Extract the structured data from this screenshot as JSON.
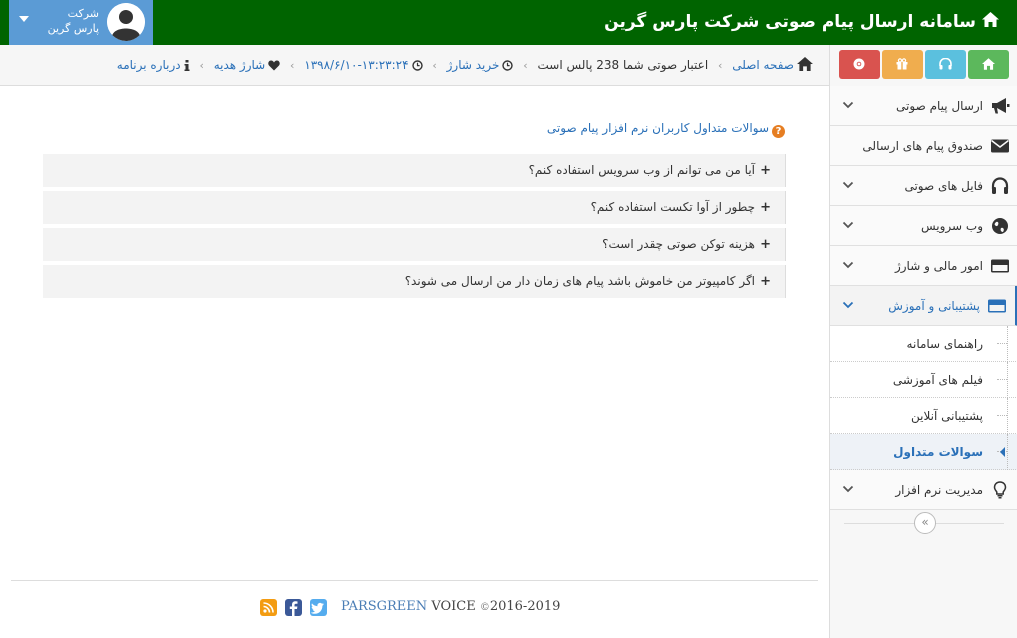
{
  "header": {
    "title": "سامانه ارسال پیام صوتی شرکت پارس گرین",
    "user_line1": "شرکت",
    "user_line2": "پارس گرین"
  },
  "breadcrumb": {
    "home": "صفحه اصلی",
    "credit": "اعتبار صوتی شما 238 پالس است",
    "buy": "خرید شارژ",
    "datetime": "۱۳۹۸/۶/۱۰-۱۳:۲۳:۲۴",
    "gift": "شارژ هدیه",
    "about": "درباره برنامه"
  },
  "colors": {
    "header_bg": "#006400",
    "user_bg": "#5b9bd5",
    "btn_green": "#5cb85c",
    "btn_blue": "#5bc0de",
    "btn_orange": "#f0ad4e",
    "btn_red": "#d9534f",
    "link": "#2a70b8"
  },
  "sidebar": {
    "top_buttons": [
      "home-icon",
      "headphones-icon",
      "gift-icon",
      "chrome-icon"
    ],
    "items": [
      {
        "label": "ارسال پیام صوتی",
        "icon": "megaphone-icon",
        "chevron": true
      },
      {
        "label": "صندوق پیام های ارسالی",
        "icon": "envelope-icon",
        "chevron": false
      },
      {
        "label": "فایل های صوتی",
        "icon": "headphones-icon",
        "chevron": true
      },
      {
        "label": "وب سرویس",
        "icon": "globe-icon",
        "chevron": true
      },
      {
        "label": "امور مالی و شارژ",
        "icon": "credit-card-icon",
        "chevron": true
      },
      {
        "label": "پشتیبانی و آموزش",
        "icon": "credit-card-icon",
        "chevron": true
      }
    ],
    "sub_items": [
      "راهنمای سامانه",
      "فیلم های آموزشی",
      "پشتیبانی آنلاین",
      "سوالات متداول"
    ],
    "last_item": {
      "label": "مدیریت نرم افزار",
      "icon": "lightbulb-icon"
    },
    "collapse": "«"
  },
  "faq": {
    "title": "سوالات متداول کاربران نرم افزار پیام صوتی",
    "questions": [
      "آیا من می توانم از وب سرویس استفاده کنم؟",
      "چطور از آوا تکست استفاده کنم؟",
      "هزینه توکن صوتی چقدر است؟",
      "اگر کامپیوتر من خاموش باشد پیام های زمان دار من ارسال می شوند؟"
    ]
  },
  "footer": {
    "brand": "PARSGREEN",
    "product": "VOICE",
    "copy_symbol": "©",
    "years": "2016-2019"
  }
}
